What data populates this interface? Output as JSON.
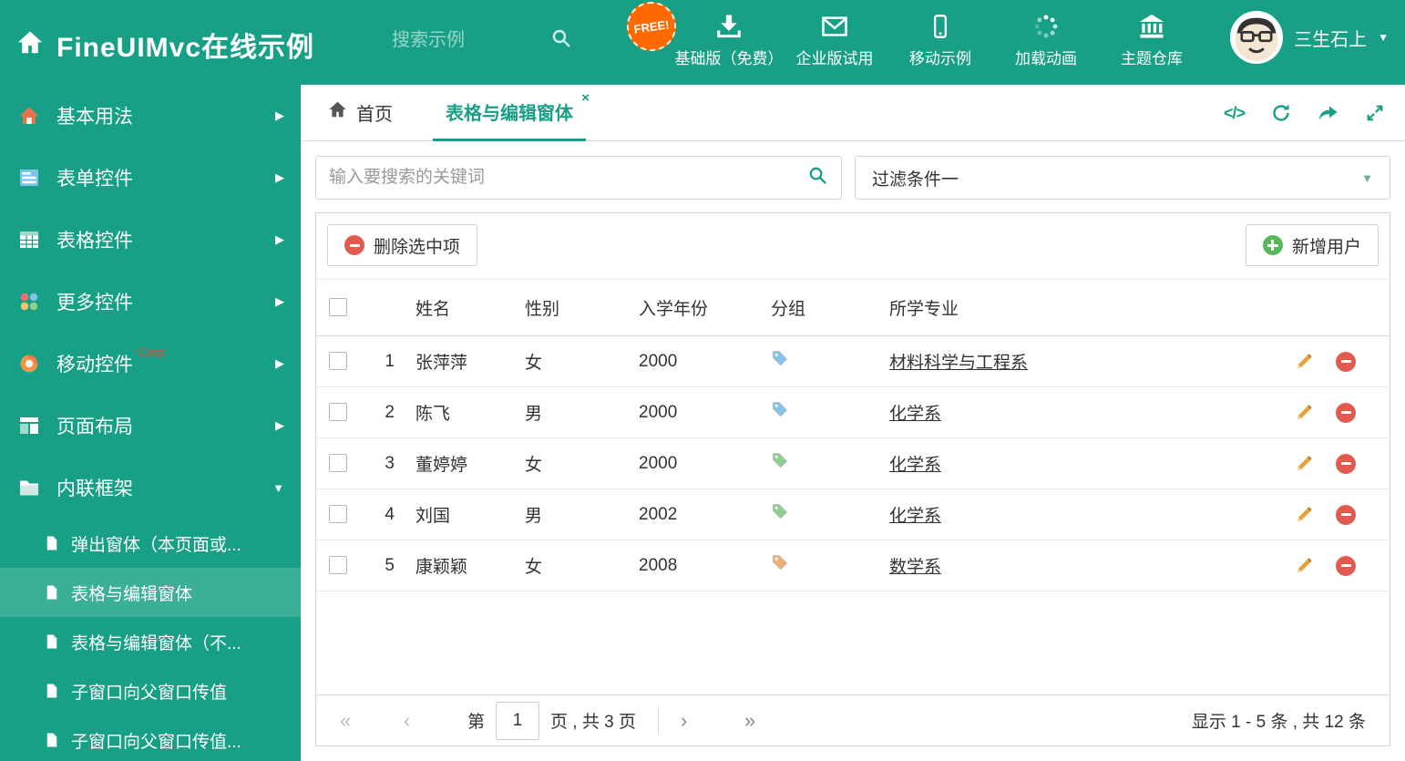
{
  "colors": {
    "theme": "#17a086",
    "danger": "#e25a4e",
    "success": "#57b85a",
    "free_badge_bg": "#ff6a00"
  },
  "header": {
    "title": "FineUIMvc在线示例",
    "search_placeholder": "搜索示例",
    "free_badge": "FREE!",
    "nav": [
      {
        "label": "基础版（免费）"
      },
      {
        "label": "企业版试用"
      },
      {
        "label": "移动示例"
      },
      {
        "label": "加载动画"
      },
      {
        "label": "主题仓库"
      }
    ],
    "user_name": "三生石上"
  },
  "sidebar": {
    "items": [
      {
        "label": "基本用法"
      },
      {
        "label": "表单控件"
      },
      {
        "label": "表格控件"
      },
      {
        "label": "更多控件"
      },
      {
        "label": "移动控件",
        "badge": "Corp"
      },
      {
        "label": "页面布局"
      },
      {
        "label": "内联框架"
      }
    ],
    "subitems": [
      {
        "label": "弹出窗体（本页面或..."
      },
      {
        "label": "表格与编辑窗体"
      },
      {
        "label": "表格与编辑窗体（不..."
      },
      {
        "label": "子窗口向父窗口传值"
      },
      {
        "label": "子窗口向父窗口传值..."
      }
    ]
  },
  "tabs": {
    "home_label": "首页",
    "active_label": "表格与编辑窗体",
    "close": "×"
  },
  "filters": {
    "search_placeholder": "输入要搜索的关键词",
    "filter_value": "过滤条件一"
  },
  "toolbar": {
    "delete_label": "删除选中项",
    "add_label": "新增用户"
  },
  "table": {
    "headers": {
      "name": "姓名",
      "gender": "性别",
      "year": "入学年份",
      "group": "分组",
      "major": "所学专业"
    },
    "rows": [
      {
        "num": "1",
        "name": "张萍萍",
        "gender": "女",
        "year": "2000",
        "tag_color": "#85c5ea",
        "major": "材料科学与工程系"
      },
      {
        "num": "2",
        "name": "陈飞",
        "gender": "男",
        "year": "2000",
        "tag_color": "#85c5ea",
        "major": "化学系"
      },
      {
        "num": "3",
        "name": "董婷婷",
        "gender": "女",
        "year": "2000",
        "tag_color": "#8fcf8f",
        "major": "化学系"
      },
      {
        "num": "4",
        "name": "刘国",
        "gender": "男",
        "year": "2002",
        "tag_color": "#8fcf8f",
        "major": "化学系"
      },
      {
        "num": "5",
        "name": "康颖颖",
        "gender": "女",
        "year": "2008",
        "tag_color": "#f2b077",
        "major": "数学系"
      }
    ]
  },
  "pagination": {
    "page_label": "第",
    "current_page": "1",
    "pages_label": "页 , 共 3 页",
    "summary": "显示 1 - 5 条 , 共 12 条"
  }
}
